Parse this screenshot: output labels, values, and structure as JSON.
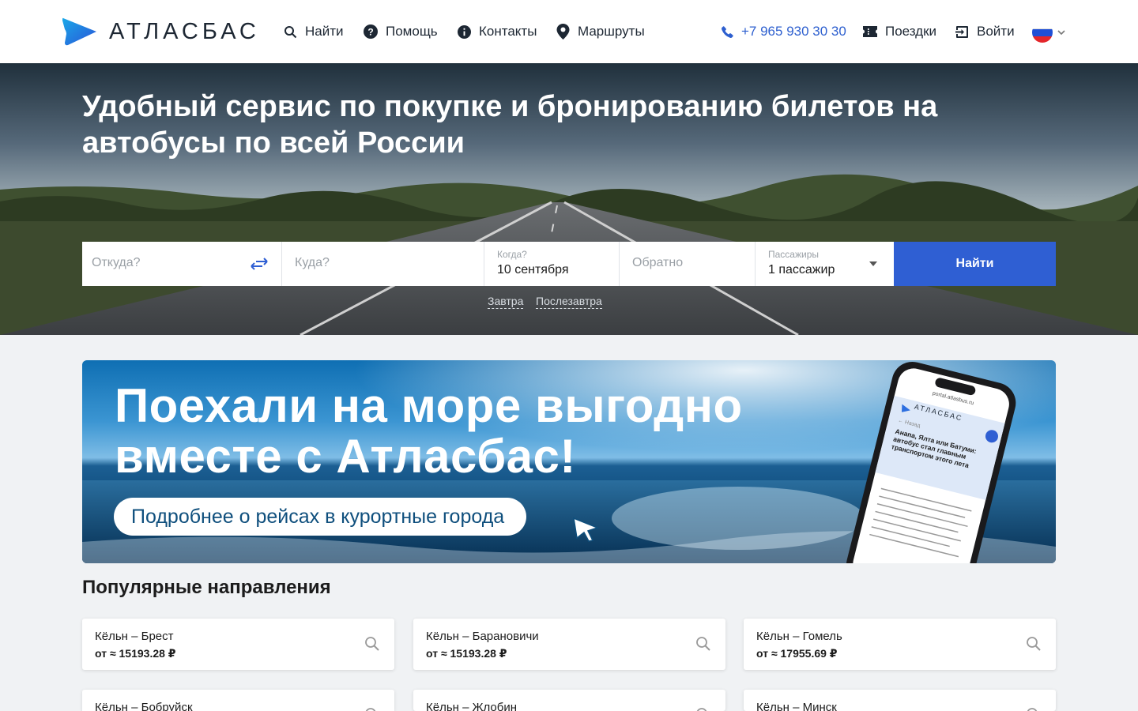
{
  "header": {
    "logo_text": "АТЛАСБАС",
    "nav": [
      {
        "label": "Найти",
        "icon": "search-icon"
      },
      {
        "label": "Помощь",
        "icon": "help-icon"
      },
      {
        "label": "Контакты",
        "icon": "info-icon"
      },
      {
        "label": "Маршруты",
        "icon": "map-pin-icon"
      }
    ],
    "phone": "+7 965 930 30 30",
    "trips": "Поездки",
    "login": "Войти",
    "language_icon": "russia-flag-icon"
  },
  "hero": {
    "title": "Удобный сервис по покупке и бронированию билетов на автобусы по всей России"
  },
  "search": {
    "from_placeholder": "Откуда?",
    "to_placeholder": "Куда?",
    "when_label": "Когда?",
    "when_value": "10 сентября",
    "back_placeholder": "Обратно",
    "passengers_label": "Пассажиры",
    "passengers_value": "1 пассажир",
    "submit_label": "Найти",
    "quick_dates": [
      "Завтра",
      "Послезавтра"
    ]
  },
  "promo": {
    "title_line1": "Поехали на море выгодно",
    "title_line2": "вместе с Атласбас!",
    "button_label": "Подробнее о рейсах в курортные города",
    "phone_logo": "АТЛАСБАС",
    "phone_url": "portal.atlasbus.ru",
    "phone_back": "← Назад",
    "phone_heading": "Анапа, Ялта или Батуми: автобус стал главным транспортом этого лета"
  },
  "popular": {
    "title": "Популярные направления",
    "items": [
      {
        "route": "Кёльн – Брест",
        "price": "от ≈ 15193.28 ₽"
      },
      {
        "route": "Кёльн – Барановичи",
        "price": "от ≈ 15193.28 ₽"
      },
      {
        "route": "Кёльн – Гомель",
        "price": "от ≈ 17955.69 ₽"
      },
      {
        "route": "Кёльн – Бобруйск",
        "price": ""
      },
      {
        "route": "Кёльн – Жлобин",
        "price": ""
      },
      {
        "route": "Кёльн – Минск",
        "price": ""
      }
    ]
  },
  "colors": {
    "accent": "#2f5fd3",
    "logo_blue": "#2d6fe0",
    "phone_link": "#2d5fcf"
  }
}
